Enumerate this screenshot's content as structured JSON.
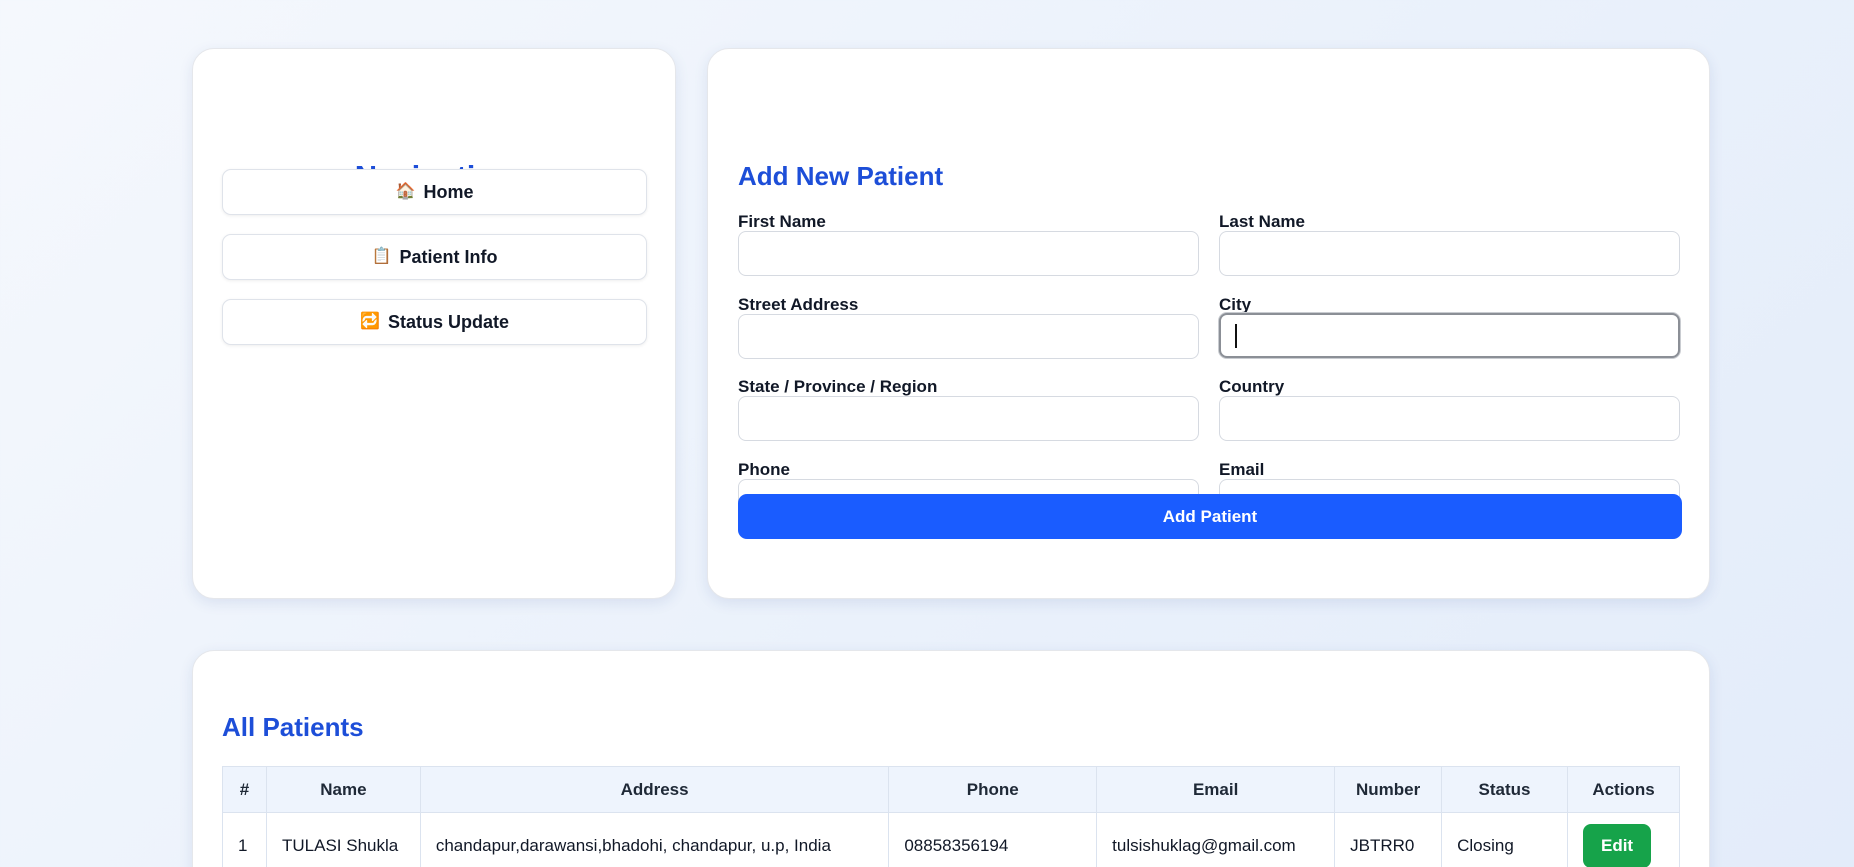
{
  "navigation": {
    "title": "Navigation",
    "items": [
      {
        "icon": "house-icon",
        "glyph": "🏠",
        "label": "Home"
      },
      {
        "icon": "clipboard-icon",
        "glyph": "📋",
        "label": "Patient Info"
      },
      {
        "icon": "repeat-icon",
        "glyph": "🔁",
        "label": "Status Update"
      }
    ]
  },
  "form": {
    "title": "Add New Patient",
    "fields": {
      "first_name": {
        "label": "First Name",
        "value": ""
      },
      "last_name": {
        "label": "Last Name",
        "value": ""
      },
      "street_address": {
        "label": "Street Address",
        "value": ""
      },
      "city": {
        "label": "City",
        "value": ""
      },
      "state": {
        "label": "State / Province / Region",
        "value": ""
      },
      "country": {
        "label": "Country",
        "value": ""
      },
      "phone": {
        "label": "Phone",
        "value": ""
      },
      "email": {
        "label": "Email",
        "value": ""
      }
    },
    "submit_label": "Add Patient"
  },
  "patients": {
    "title": "All Patients",
    "columns": [
      "#",
      "Name",
      "Address",
      "Phone",
      "Email",
      "Number",
      "Status",
      "Actions"
    ],
    "rows": [
      {
        "index": "1",
        "name": "TULASI Shukla",
        "address": "chandapur,darawansi,bhadohi, chandapur, u.p, India",
        "phone": "08858356194",
        "email": "tulsishuklag@gmail.com",
        "number": "JBTRR0",
        "status": "Closing",
        "action_label": "Edit"
      }
    ]
  },
  "colors": {
    "accent": "#1d4ed8",
    "primary_button": "#1a5cff",
    "edit_button": "#16a34a",
    "table_header_bg": "#eef4fd"
  }
}
